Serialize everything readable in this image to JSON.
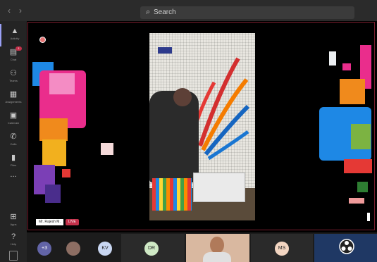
{
  "titlebar": {
    "search": {
      "placeholder": "Search",
      "icon": "search-icon"
    },
    "back_icon": "chevron-left-icon",
    "forward_icon": "chevron-right-icon"
  },
  "rail": {
    "items": [
      {
        "label": "Activity",
        "icon": "bell-icon",
        "active": true
      },
      {
        "label": "Chat",
        "icon": "chat-icon",
        "badge": "1"
      },
      {
        "label": "Teams",
        "icon": "teams-icon"
      },
      {
        "label": "Assignments",
        "icon": "assignments-icon"
      },
      {
        "label": "Calendar",
        "icon": "calendar-icon"
      },
      {
        "label": "Calls",
        "icon": "phone-icon"
      },
      {
        "label": "Files",
        "icon": "file-icon"
      },
      {
        "label": "...",
        "icon": "more-icon"
      },
      {
        "label": "Apps",
        "icon": "apps-icon"
      },
      {
        "label": "Help",
        "icon": "help-icon"
      }
    ]
  },
  "stage": {
    "presenter_name": "Mr. Rajesh M.",
    "live_label": "LIVE"
  },
  "participants": {
    "overflow_count": "+3",
    "avatars": [
      {
        "initials": "KV",
        "color": "#c9d7f2"
      },
      {
        "initials": "DR",
        "color": "#cfe9c5"
      },
      {
        "initials": "MS",
        "color": "#f3d6c2"
      }
    ]
  },
  "colors": {
    "accent": "#9aa0f5",
    "live": "#c4314b",
    "stage_border": "#7a1d2e"
  }
}
